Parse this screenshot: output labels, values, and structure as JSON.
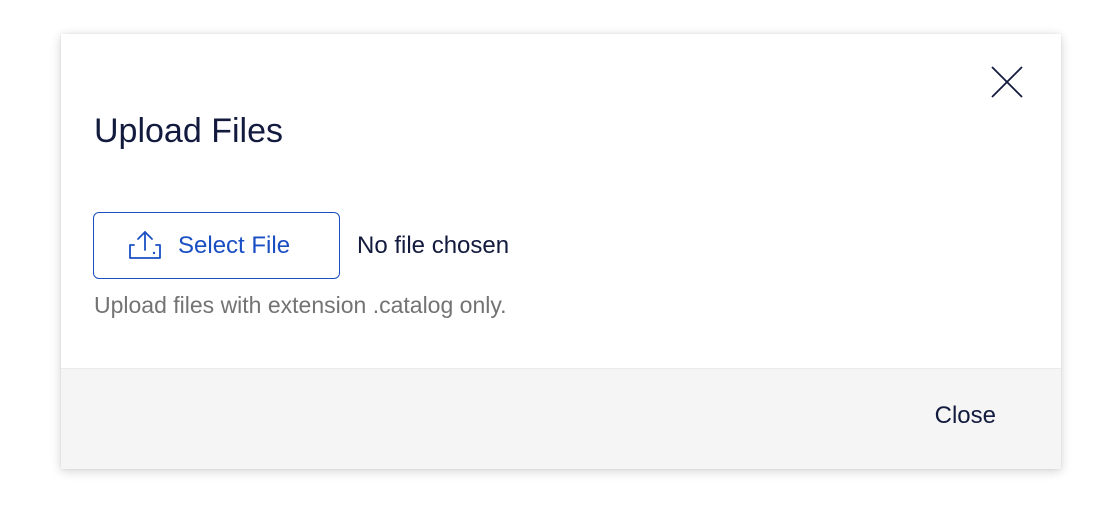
{
  "dialog": {
    "title": "Upload Files",
    "select_file_label": "Select File",
    "file_status": "No file chosen",
    "hint": "Upload files with extension .catalog only.",
    "close_label": "Close"
  },
  "icons": {
    "close": "close-icon",
    "upload": "upload-icon"
  },
  "colors": {
    "accent": "#1a4fc4",
    "title": "#121a3d",
    "hint": "#737373",
    "footer_bg": "#f5f5f5"
  }
}
